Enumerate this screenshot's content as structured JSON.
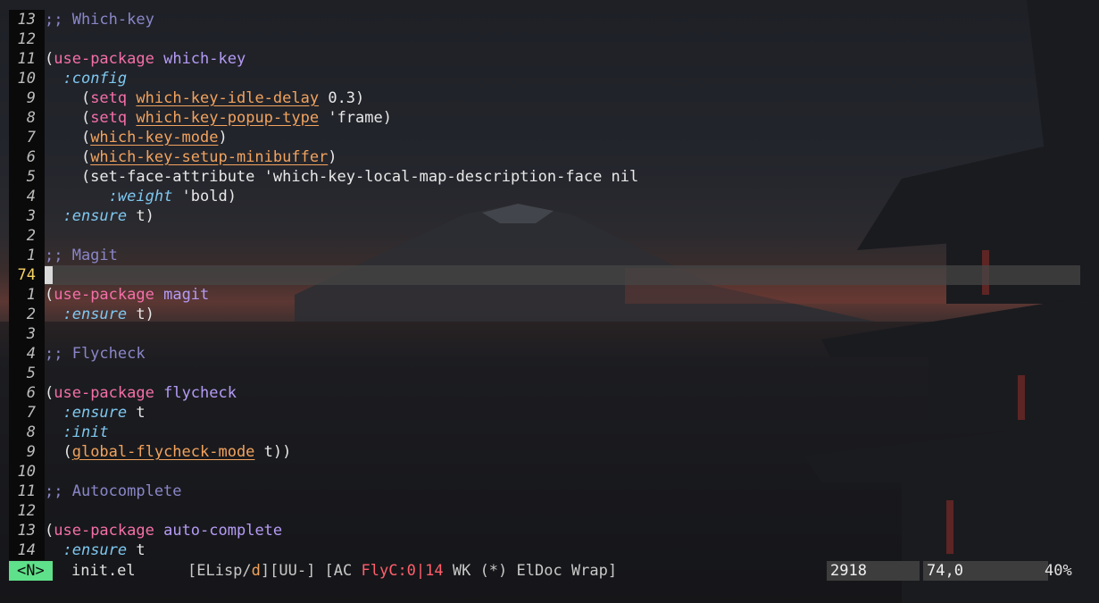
{
  "editor": {
    "lines": [
      {
        "num": "13",
        "parts": [
          {
            "t": ";; Which-key",
            "c": "cmt"
          }
        ]
      },
      {
        "num": "12",
        "parts": []
      },
      {
        "num": "11",
        "parts": [
          {
            "t": "(",
            "c": "paren"
          },
          {
            "t": "use-package",
            "c": "kw"
          },
          {
            "t": " ",
            "c": ""
          },
          {
            "t": "which-key",
            "c": "fn"
          }
        ]
      },
      {
        "num": "10",
        "parts": [
          {
            "t": "  ",
            "c": ""
          },
          {
            "t": ":config",
            "c": "kwd"
          }
        ]
      },
      {
        "num": "9",
        "parts": [
          {
            "t": "    (",
            "c": "paren"
          },
          {
            "t": "setq",
            "c": "kw"
          },
          {
            "t": " ",
            "c": ""
          },
          {
            "t": "which-key-idle-delay",
            "c": "var"
          },
          {
            "t": " 0.3)",
            "c": ""
          }
        ]
      },
      {
        "num": "8",
        "parts": [
          {
            "t": "    (",
            "c": "paren"
          },
          {
            "t": "setq",
            "c": "kw"
          },
          {
            "t": " ",
            "c": ""
          },
          {
            "t": "which-key-popup-type",
            "c": "var"
          },
          {
            "t": " 'frame)",
            "c": ""
          }
        ]
      },
      {
        "num": "7",
        "parts": [
          {
            "t": "    (",
            "c": "paren"
          },
          {
            "t": "which-key-mode",
            "c": "var"
          },
          {
            "t": ")",
            "c": ""
          }
        ]
      },
      {
        "num": "6",
        "parts": [
          {
            "t": "    (",
            "c": "paren"
          },
          {
            "t": "which-key-setup-minibuffer",
            "c": "var"
          },
          {
            "t": ")",
            "c": ""
          }
        ]
      },
      {
        "num": "5",
        "parts": [
          {
            "t": "    (set-face-attribute 'which-key-local-map-description-face nil",
            "c": ""
          }
        ]
      },
      {
        "num": "4",
        "parts": [
          {
            "t": "       ",
            "c": ""
          },
          {
            "t": ":weight",
            "c": "kwd"
          },
          {
            "t": " 'bold)",
            "c": ""
          }
        ]
      },
      {
        "num": "3",
        "parts": [
          {
            "t": "  ",
            "c": ""
          },
          {
            "t": ":ensure",
            "c": "kwd"
          },
          {
            "t": " t)",
            "c": ""
          }
        ]
      },
      {
        "num": "2",
        "parts": []
      },
      {
        "num": "1",
        "parts": [
          {
            "t": ";; Magit",
            "c": "cmt"
          }
        ]
      },
      {
        "num": "74",
        "current": true,
        "parts": []
      },
      {
        "num": "1",
        "parts": [
          {
            "t": "(",
            "c": "paren"
          },
          {
            "t": "use-package",
            "c": "kw"
          },
          {
            "t": " ",
            "c": ""
          },
          {
            "t": "magit",
            "c": "fn"
          }
        ]
      },
      {
        "num": "2",
        "parts": [
          {
            "t": "  ",
            "c": ""
          },
          {
            "t": ":ensure",
            "c": "kwd"
          },
          {
            "t": " t)",
            "c": ""
          }
        ]
      },
      {
        "num": "3",
        "parts": []
      },
      {
        "num": "4",
        "parts": [
          {
            "t": ";; Flycheck",
            "c": "cmt"
          }
        ]
      },
      {
        "num": "5",
        "parts": []
      },
      {
        "num": "6",
        "parts": [
          {
            "t": "(",
            "c": "paren"
          },
          {
            "t": "use-package",
            "c": "kw"
          },
          {
            "t": " ",
            "c": ""
          },
          {
            "t": "flycheck",
            "c": "fn"
          }
        ]
      },
      {
        "num": "7",
        "parts": [
          {
            "t": "  ",
            "c": ""
          },
          {
            "t": ":ensure",
            "c": "kwd"
          },
          {
            "t": " t",
            "c": ""
          }
        ]
      },
      {
        "num": "8",
        "parts": [
          {
            "t": "  ",
            "c": ""
          },
          {
            "t": ":init",
            "c": "kwd"
          }
        ]
      },
      {
        "num": "9",
        "parts": [
          {
            "t": "  (",
            "c": "paren"
          },
          {
            "t": "global-flycheck-mode",
            "c": "var"
          },
          {
            "t": " t))",
            "c": ""
          }
        ]
      },
      {
        "num": "10",
        "parts": []
      },
      {
        "num": "11",
        "parts": [
          {
            "t": ";; Autocomplete",
            "c": "cmt"
          }
        ]
      },
      {
        "num": "12",
        "parts": []
      },
      {
        "num": "13",
        "parts": [
          {
            "t": "(",
            "c": "paren"
          },
          {
            "t": "use-package",
            "c": "kw"
          },
          {
            "t": " ",
            "c": ""
          },
          {
            "t": "auto-complete",
            "c": "fn"
          }
        ]
      },
      {
        "num": "14",
        "parts": [
          {
            "t": "  ",
            "c": ""
          },
          {
            "t": ":ensure",
            "c": "kwd"
          },
          {
            "t": " t",
            "c": ""
          }
        ]
      }
    ]
  },
  "modeline": {
    "evil_state": "<N>",
    "filename": "init.el",
    "modes_prefix": "[ELisp/",
    "modes_d": "d",
    "modes_mid": "][UU-] [AC ",
    "modes_fly": "FlyC:0|14",
    "modes_suffix": " WK (*) ElDoc Wrap]",
    "char_count": "2918",
    "line_col": "74,0",
    "percent": "40%"
  },
  "colors": {
    "evil_normal": "#5fe08a",
    "comment": "#8a86c8",
    "keyword": "#f56fa8",
    "function": "#b59bf5",
    "variable": "#f2a35e",
    "keyword_arg": "#7ec8f0",
    "flycheck": "#ff5f6b"
  }
}
